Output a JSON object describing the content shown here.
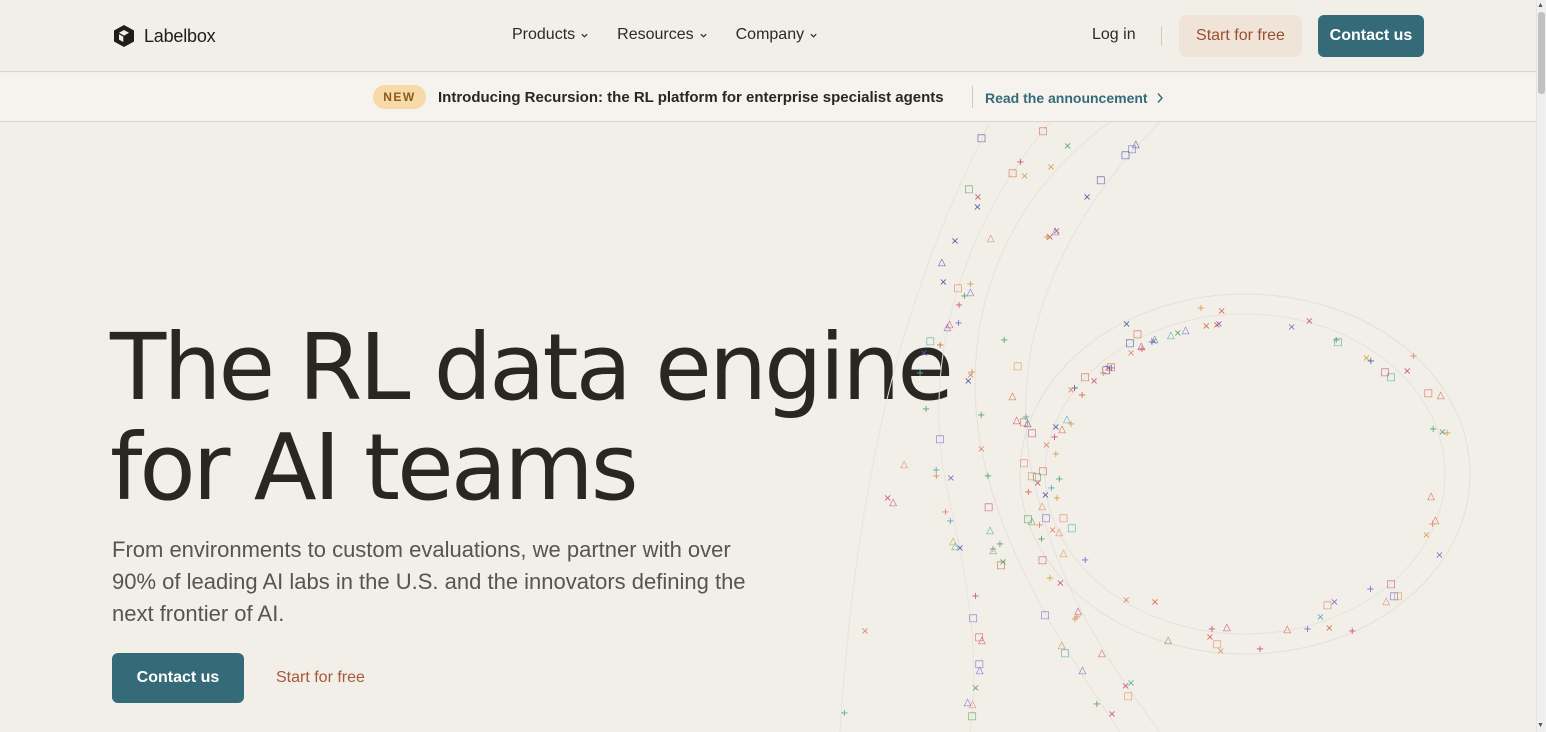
{
  "brand": {
    "name": "Labelbox"
  },
  "nav": {
    "items": [
      {
        "label": "Products"
      },
      {
        "label": "Resources"
      },
      {
        "label": "Company"
      }
    ],
    "login": "Log in",
    "start_free": "Start for free",
    "contact": "Contact us"
  },
  "announcement": {
    "badge": "NEW",
    "text": "Introducing Recursion: the RL platform for enterprise specialist agents",
    "link": "Read the announcement"
  },
  "hero": {
    "headline_line1": "The RL data engine",
    "headline_line2": "for AI teams",
    "subtitle": "From environments to custom evaluations, we partner with over 90% of leading AI labs in the U.S. and the innovators defining the next frontier of AI.",
    "contact": "Contact us",
    "start_free": "Start for free"
  },
  "colors": {
    "accent": "#356b78",
    "cta_text": "#a8573a",
    "background": "#f2eee8",
    "badge_bg": "#f8d9a8"
  },
  "icons": [
    "labelbox-logo-icon",
    "chevron-down-icon",
    "chevron-right-icon"
  ]
}
